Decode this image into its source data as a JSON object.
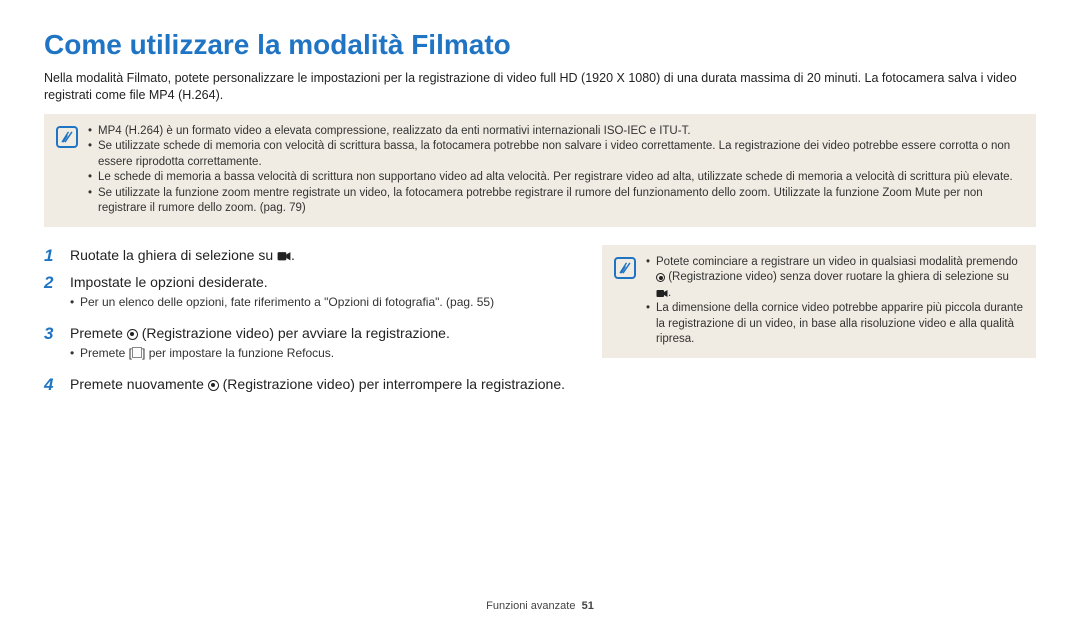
{
  "title": "Come utilizzare la modalità Filmato",
  "intro": "Nella modalità Filmato, potete personalizzare le impostazioni per la registrazione di video full HD (1920 X 1080) di una durata massima di 20 minuti. La fotocamera salva i video registrati come file MP4 (H.264).",
  "top_notes": [
    "MP4 (H.264) è un formato video a elevata compressione, realizzato da enti normativi internazionali ISO-IEC e ITU-T.",
    "Se utilizzate schede di memoria con velocità di scrittura bassa, la fotocamera potrebbe non salvare i video correttamente. La registrazione dei video potrebbe essere corrotta o non essere riprodotta correttamente.",
    "Le schede di memoria a bassa velocità di scrittura non supportano video ad alta velocità. Per registrare video ad alta, utilizzate schede di memoria a velocità di scrittura più elevate.",
    "Se utilizzate la funzione zoom mentre registrate un video, la fotocamera potrebbe registrare il rumore del funzionamento dello zoom. Utilizzate la funzione Zoom Mute per non registrare il rumore dello zoom. (pag. 79)"
  ],
  "steps": {
    "s1_a": "Ruotate la ghiera di selezione su ",
    "s1_b": ".",
    "s2": "Impostate le opzioni desiderate.",
    "s2_sub": "Per un elenco delle opzioni, fate riferimento a \"Opzioni di fotografia\". (pag. 55)",
    "s3_a": "Premete ",
    "s3_b": " (Registrazione video) per avviare la registrazione.",
    "s3_sub_a": "Premete [",
    "s3_sub_b": "] per impostare la funzione Refocus.",
    "s4_a": "Premete nuovamente ",
    "s4_b": " (Registrazione video) per interrompere la registrazione."
  },
  "side_notes": {
    "n1_a": "Potete cominciare a registrare un video in qualsiasi modalità premendo ",
    "n1_b": " (Registrazione video) senza dover ruotare la ghiera di selezione su ",
    "n1_c": ".",
    "n2": "La dimensione della cornice video potrebbe apparire più piccola durante la registrazione di un video, in base alla risoluzione video e alla qualità ripresa."
  },
  "footer_label": "Funzioni avanzate",
  "page_number": "51"
}
